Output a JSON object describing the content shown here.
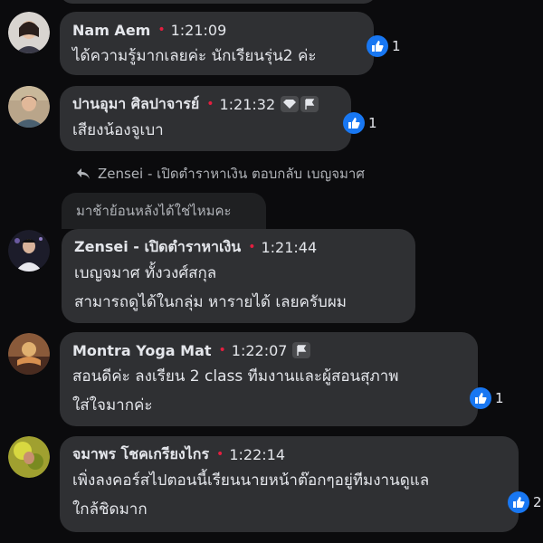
{
  "comments": [
    {
      "name": "Nam Aem",
      "time": "1:21:09",
      "lines": [
        "ได้ความรู้มากเลยค่ะ นักเรียนรุ่น2 ค่ะ"
      ],
      "likes": "1",
      "badges": []
    },
    {
      "name": "ปานอุมา ศิลปาจารย์",
      "time": "1:21:32",
      "lines": [
        "เสียงน้องจูเบา"
      ],
      "likes": "1",
      "badges": [
        "diamond-icon",
        "flag-icon"
      ]
    },
    {
      "name": "Zensei - เปิดตำราหาเงิน",
      "time": "1:21:44",
      "lines": [
        "เบญจมาศ ทั้งวงศ์สกุล",
        "สามารถดูได้ในกลุ่ม หารายได้ เลยครับผม"
      ],
      "likes": "",
      "badges": []
    },
    {
      "name": "Montra Yoga Mat",
      "time": "1:22:07",
      "lines": [
        "สอนดีค่ะ ลงเรียน 2 class  ทีมงานและผู้สอนสุภาพ",
        "ใส่ใจมากค่ะ"
      ],
      "likes": "1",
      "badges": [
        "flag-icon"
      ]
    },
    {
      "name": "จมาพร โชคเกรียงไกร",
      "time": "1:22:14",
      "lines": [
        "เพิ่งลงคอร์สไปตอนนี้เรียนนายหน้าต๊อกๆอยู่ทีมงานดูแล",
        "ใกล้ชิดมาก"
      ],
      "likes": "2",
      "badges": []
    }
  ],
  "reply": {
    "text": "Zensei - เปิดตำราหาเงิน ตอบกลับ เบญจมาศ",
    "quoted": "มาช้าย้อนหลังได้ใช่ไหมคะ"
  },
  "colors": {
    "like": "#1877f2",
    "dot": "#e41e3f",
    "bubble": "#2f3033"
  }
}
